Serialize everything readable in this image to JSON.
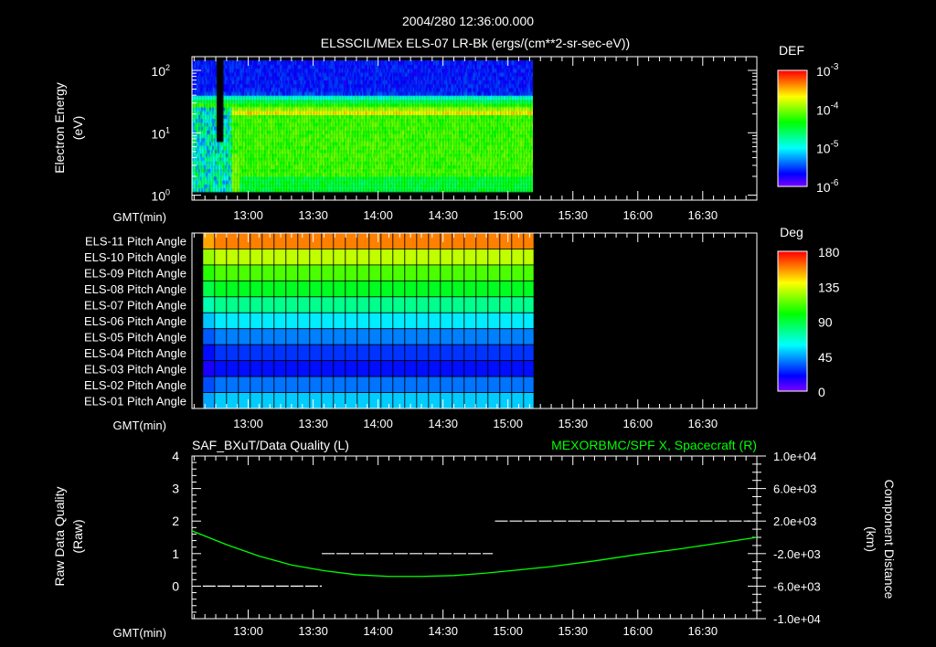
{
  "header": {
    "title": "2004/280 12:36:00.000",
    "subtitle": "ELSSCIL/MEx ELS-07 LR-Bk  (ergs/(cm**2-sr-sec-eV))"
  },
  "colors": {
    "background": "#000000",
    "axis": "#ffffff",
    "orbit_line": "#00ff00"
  },
  "chart_data": [
    {
      "type": "heatmap",
      "name": "energy-spectrogram",
      "ylabel": [
        "Electron Energy",
        "(eV)"
      ],
      "xlabel": "GMT(min)",
      "yscale": "log",
      "ylim": [
        0.83,
        166
      ],
      "yticks": [
        {
          "base": "10",
          "exp": "0"
        },
        {
          "base": "10",
          "exp": "1"
        },
        {
          "base": "10",
          "exp": "2"
        }
      ],
      "xlim_minutes": [
        754,
        1015
      ],
      "xticks": [
        "13:00",
        "13:30",
        "14:00",
        "14:30",
        "15:00",
        "15:30",
        "16:00",
        "16:30"
      ],
      "data_end_minutes": 912,
      "colorbar": {
        "label": "DEF",
        "scale": "log",
        "range": [
          1e-06,
          0.001
        ],
        "ticks": [
          {
            "base": "10",
            "exp": "-3"
          },
          {
            "base": "10",
            "exp": "-4"
          },
          {
            "base": "10",
            "exp": "-5"
          },
          {
            "base": "10",
            "exp": "-6"
          }
        ]
      },
      "description_levels": {
        "low_energy_log_def": -4.2,
        "mid_energy_log_def": -4.1,
        "high_energy_log_def": -5.6
      }
    },
    {
      "type": "heatmap",
      "name": "pitch-angle",
      "xlabel": "GMT(min)",
      "xlim_minutes": [
        754,
        1015
      ],
      "xticks": [
        "13:00",
        "13:30",
        "14:00",
        "14:30",
        "15:00",
        "15:30",
        "16:00",
        "16:30"
      ],
      "data_start_minutes": 759,
      "data_end_minutes": 912,
      "rows": [
        "ELS-11 Pitch Angle",
        "ELS-10 Pitch Angle",
        "ELS-09 Pitch Angle",
        "ELS-08 Pitch Angle",
        "ELS-07 Pitch Angle",
        "ELS-06 Pitch Angle",
        "ELS-05 Pitch Angle",
        "ELS-04 Pitch Angle",
        "ELS-03 Pitch Angle",
        "ELS-02 Pitch Angle",
        "ELS-01 Pitch Angle"
      ],
      "values_deg": [
        160,
        130,
        112,
        95,
        78,
        57,
        40,
        28,
        22,
        38,
        52
      ],
      "colorbar": {
        "label": "Deg",
        "range": [
          0,
          180
        ],
        "ticks": [
          "180",
          "135",
          "90",
          "45",
          "0"
        ]
      }
    },
    {
      "type": "line",
      "name": "quality-and-orbit",
      "title_left": "SAF_BXuT/Data Quality (L)",
      "title_right": "MEXORBMC/SPF X, Spacecraft (R)",
      "xlabel": "GMT(min)",
      "ylabel_left": [
        "Raw Data Quality",
        "(Raw)"
      ],
      "ylabel_right": [
        "Component Distance",
        "(km)"
      ],
      "xlim_minutes": [
        754,
        1015
      ],
      "xticks": [
        "13:00",
        "13:30",
        "14:00",
        "14:30",
        "15:00",
        "15:30",
        "16:00",
        "16:30"
      ],
      "ylim_left": [
        -1,
        4
      ],
      "yticks_left": [
        "4",
        "3",
        "2",
        "1",
        "0"
      ],
      "ylim_right": [
        -10000,
        10000
      ],
      "yticks_right": [
        "1.0e+04",
        "6.0e+03",
        "2.0e+03",
        "-2.0e+03",
        "-6.0e+03",
        "-1.0e+04"
      ],
      "series": [
        {
          "name": "Data Quality",
          "axis": "left",
          "segments": [
            {
              "x": [
                759,
                814
              ],
              "y": 0
            },
            {
              "x": [
                814,
                893
              ],
              "y": 1
            },
            {
              "x": [
                894,
                1012
              ],
              "y": 2
            }
          ]
        },
        {
          "name": "SPF X Spacecraft",
          "axis": "right",
          "x": [
            754,
            770,
            785,
            800,
            815,
            830,
            845,
            860,
            875,
            890,
            905,
            920,
            940,
            960,
            980,
            1000,
            1015
          ],
          "y": [
            800,
            -900,
            -2300,
            -3400,
            -4100,
            -4600,
            -4800,
            -4800,
            -4700,
            -4400,
            -4000,
            -3600,
            -2900,
            -2100,
            -1400,
            -600,
            0
          ]
        }
      ]
    }
  ]
}
